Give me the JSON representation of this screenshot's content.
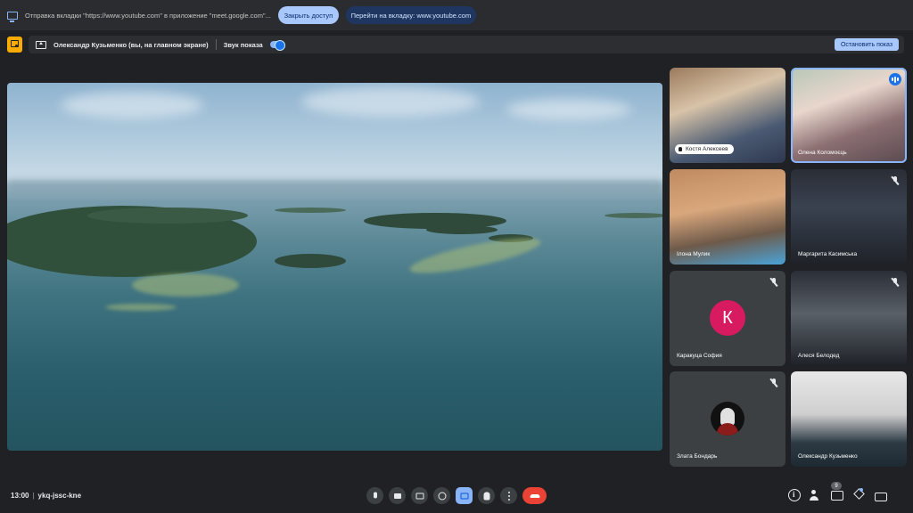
{
  "share_bar": {
    "message": "Отправка вкладки \"https://www.youtube.com\" в приложение \"meet.google.com\"...",
    "allow_label": "Закрыть доступ",
    "goto_label": "Перейти на вкладку: www.youtube.com"
  },
  "present_bar": {
    "presenter": "Олександр Кузьменко (вы, на главном экране)",
    "sound_label": "Звук показа",
    "sound_on": true,
    "stop_label": "Остановить показ"
  },
  "participants": [
    {
      "name": "Костя Алексеев",
      "muted": false
    },
    {
      "name": "Олена Коломоєць",
      "muted": false,
      "speaking": true
    },
    {
      "name": "Ілона Мулик",
      "muted": false
    },
    {
      "name": "Маргарита Касимська",
      "muted": true
    },
    {
      "name": "Каракуца София",
      "muted": true,
      "avatar_letter": "К"
    },
    {
      "name": "Алеся Белодед",
      "muted": true
    },
    {
      "name": "Злата Бондарь",
      "muted": true
    },
    {
      "name": "Олександр Кузьменко",
      "muted": false
    }
  ],
  "bottom_bar": {
    "time": "13:00",
    "meeting_code": "ykq-jssc-kne",
    "participant_count": "9",
    "controls": [
      "mic-icon",
      "camera-icon",
      "captions-icon",
      "emoji-icon",
      "present-icon",
      "raise-hand-icon",
      "more-options-icon",
      "end-call-icon"
    ],
    "right_controls": [
      "info-icon",
      "people-icon",
      "chat-icon",
      "activities-icon",
      "host-controls-icon"
    ]
  },
  "colors": {
    "accent": "#8ab4f8",
    "end_call": "#ea4335",
    "avatar_k": "#d81b60",
    "logo": "#f9ab00"
  }
}
